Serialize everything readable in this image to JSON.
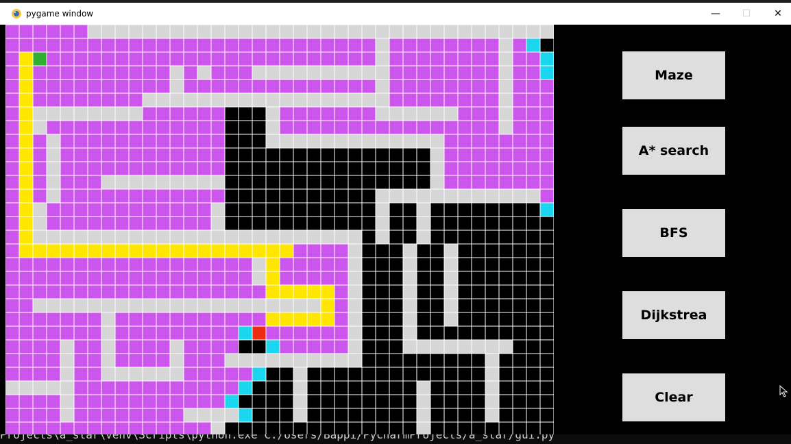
{
  "window": {
    "title": "pygame window",
    "controls": {
      "minimize": "—",
      "maximize": "☐",
      "close": "✕"
    }
  },
  "buttons": {
    "maze": "Maze",
    "astar": "A* search",
    "bfs": "BFS",
    "dijkstra": "Dijkstrea",
    "clear": "Clear"
  },
  "console_text": "Projects\\a_star\\venv\\Scripts\\python.exe C:/Users/Bappi/PycharmProjects/a_star/gui.py",
  "colors": {
    "purple": "#cc55ee",
    "white": "#d6d6d6",
    "black": "#000000",
    "yellow": "#ffe600",
    "cyan": "#1ad6ee",
    "green": "#2fae2f",
    "red": "#ee2a10",
    "grid_line": "#ffffff"
  },
  "grid": {
    "cols": 40,
    "rows": 30,
    "legend": "P=visited(purple) W=open(white) B=wall(black) Y=path(yellow) C=frontier(cyan) G=start(green) R=end(red)",
    "cells": [
      "PPPPPPWWWWWWWWWWWWWWWWWWWWWWWWWWWWWWWWWW",
      "PPPPPPPPPPPPPPPPPPPPPPPPPPPWPPPPPPPPWPCB",
      "PYGPPPPPPPPPPPPPPPPPPPPPPPPWPPPPPPPPWPPC",
      "PYPPPPPPPPPPWPWPPPWWWWWWWWWWPPPPPPPPWPPC",
      "PYPPPPPPPPPPWPPPPPPPPPPPPPPWPPPPPPPPWPPP",
      "PYPPPPPPPPWWWWWWWWWWWWWWWWWWPPPPPPPPWPPP",
      "PYWWWWWWWWPPPPPPBBBWPPPPPPPWWWWWWPPPWPPP",
      "PYWPPPPPPPPPPPPPBBBWPPPPPPPPPPPPPPPPWPPP",
      "PYPWPPPPPPPPPPPPBBBWWWWWWWWWWWWWPPPPPPPP",
      "PYPWPPPPPPPPPPPPBBBBBBBBBBBBBBBWPPPPPPPP",
      "PYPWPPPPPPPPPPPPBBBBBBBBBBBBBBBWPPPPPPPP",
      "PYPWPPPWWWWWWWWWBBBBBBBBBBBBBBBWPPPPPPPP",
      "PYPWPPPPPPPPPPPPBBBBBBBBBBBWWWWWWWWWWWWP",
      "PYWPPPPPPPPPPPPWBBBBBBBBBBBWBBWBBBBBBBBC",
      "PYWPPPPPPPPPPPPWBBBBBBBBBBBWBBWBBBBBBBBB",
      "PYWWWWWWWWWWWWWWWWWWWWWWWWBWBBWBBBBBBBBB",
      "PYYYYYYYYYYYYYYYYYYYYPPPPWBBBWBBWBBBBBBB",
      "PPPPPPPPPPPPPPPPPPWYPPPPPWBBBWBBWBBBBBBB",
      "PPPPPPPPPPPPPPPPPPWYPPPPPWBBBWBBWBBBBBBB",
      "PPPPPPPPPPPPPPPPPPPYYYYYPWBBBWBBWBBBBBBB",
      "PPWWWWWWWWWWWWWWWWWWWWWYPWBBBWBBWBBBBBBB",
      "PPPPPPPWPPPPPPPPPPPYYYYYPWBBBWBBWBBBBBBB",
      "PPPPPPPWPPPPPPPPPCRPPPPPPWBBBWBBBBBBBBBB",
      "PPPPWPPWPPPPWPPPPBBCPPPPPWBBBWWWWWWWWBBB",
      "PPPPWPPWPPPPWPPPWWWWWWWWWWBBBBBBBBBWBBBB",
      "PPPPWPPWWWWWWPPPPPCBBWBBBBBBBBBBBBBWBBBB",
      "WWWWWPPPPPPPPPPPPCBBBWBBBBBBBBWBBBBWBBBB",
      "PPPPWPPPPPPPPPPPCBBBBWBBBBBBBBWBBBBWBBBB",
      "PPPPWPPPPPPPPWWWWCBBBWBBBBBBBBWBBBBWBBBB",
      "PPPPPPPPPPPPPPPWBBBBBBBBBBBBBBWBBBBBBBBB"
    ]
  }
}
